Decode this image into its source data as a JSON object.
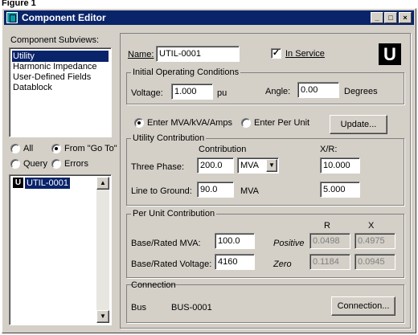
{
  "figure_label": "Figure 1",
  "window": {
    "title": "Component Editor",
    "controls": {
      "minimize": "_",
      "maximize": "□",
      "close": "×"
    }
  },
  "subviews": {
    "label": "Component Subviews:",
    "items": [
      "Utility",
      "Harmonic Impedance",
      "User-Defined Fields",
      "Datablock"
    ],
    "selected_index": 0
  },
  "filters": {
    "all": "All",
    "from_goto": "From \"Go To\"",
    "query": "Query",
    "errors": "Errors",
    "selected": "from_goto"
  },
  "component_list": {
    "items": [
      {
        "badge": "U",
        "name": "UTIL-0001"
      }
    ]
  },
  "header": {
    "name_label": "Name:",
    "name_value": "UTIL-0001",
    "in_service_label": "In Service",
    "in_service_checked": true,
    "type_badge": "U"
  },
  "initial_conditions": {
    "title": "Initial Operating Conditions",
    "voltage_label": "Voltage:",
    "voltage_value": "1.000",
    "voltage_unit": "pu",
    "angle_label": "Angle:",
    "angle_value": "0.00",
    "angle_unit": "Degrees"
  },
  "mode": {
    "mva_label": "Enter MVA/kVA/Amps",
    "pu_label": "Enter Per Unit",
    "selected": "mva",
    "update_button": "Update..."
  },
  "utility_contribution": {
    "title": "Utility Contribution",
    "contribution_header": "Contribution",
    "xr_header": "X/R:",
    "three_phase_label": "Three Phase:",
    "three_phase_value": "200.0",
    "three_phase_unit": "MVA",
    "three_phase_xr": "10.000",
    "ltg_label": "Line to Ground:",
    "ltg_value": "90.0",
    "ltg_unit": "MVA",
    "ltg_xr": "5.000"
  },
  "per_unit": {
    "title": "Per Unit Contribution",
    "r_header": "R",
    "x_header": "X",
    "base_mva_label": "Base/Rated MVA:",
    "base_mva_value": "100.0",
    "base_voltage_label": "Base/Rated Voltage:",
    "base_voltage_value": "4160",
    "positive_label": "Positive",
    "positive_r": "0.0498",
    "positive_x": "0.4975",
    "zero_label": "Zero",
    "zero_r": "0.1184",
    "zero_x": "0.0945"
  },
  "connection": {
    "title": "Connection",
    "bus_label": "Bus",
    "bus_value": "BUS-0001",
    "button": "Connection..."
  }
}
